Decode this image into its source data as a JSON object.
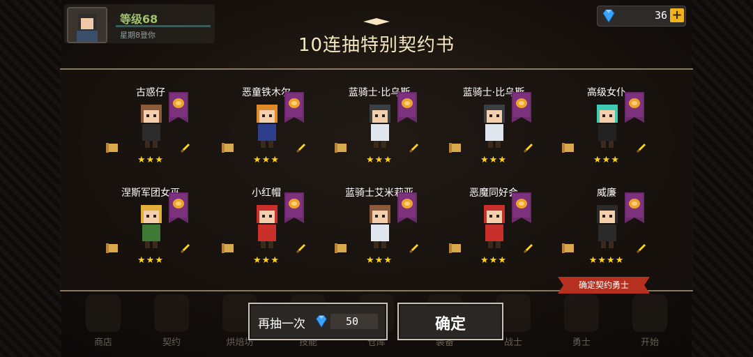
{
  "header": {
    "player_level": "等级68",
    "player_subtitle": "星期8登你",
    "gem_count": "36",
    "gem_plus": "+",
    "title": "10连抽特别契约书"
  },
  "cards": [
    {
      "name": "古惑仔",
      "stars": "★★★",
      "hair": "#8a5a3a",
      "outfit": "#2b2b2b",
      "weapon": "sword-icon"
    },
    {
      "name": "恶童铁木尔",
      "stars": "★★★",
      "hair": "#e08a2a",
      "outfit": "#2d3f8a",
      "weapon": "sword-icon"
    },
    {
      "name": "蓝骑士·比乌斯",
      "stars": "★★★",
      "hair": "#3a3f44",
      "outfit": "#dfe6ee",
      "weapon": "magic-orb-icon"
    },
    {
      "name": "蓝骑士·比乌斯",
      "stars": "★★★",
      "hair": "#3a3f44",
      "outfit": "#dfe6ee",
      "weapon": "magic-orb-icon"
    },
    {
      "name": "高级女仆",
      "stars": "★★★",
      "hair": "#3fcab3",
      "outfit": "#222222",
      "weapon": "magic-orb-icon"
    },
    {
      "name": "涅斯军团女巫",
      "stars": "★★★",
      "hair": "#e3b13a",
      "outfit": "#3e7a35",
      "weapon": "staff-icon"
    },
    {
      "name": "小红帽",
      "stars": "★★★",
      "hair": "#c9302c",
      "outfit": "#c9302c",
      "weapon": "sword-icon"
    },
    {
      "name": "蓝骑士艾米莉亚",
      "stars": "★★★",
      "hair": "#8a5a3a",
      "outfit": "#dfe6ee",
      "weapon": "arrow-icon"
    },
    {
      "name": "恶魔同好会",
      "stars": "★★★",
      "hair": "#c9302c",
      "outfit": "#c9302c",
      "weapon": "axe-icon"
    },
    {
      "name": "威廉",
      "stars": "★★★★",
      "hair": "#2a2a2a",
      "outfit": "#2a2a2a",
      "weapon": "sword-icon"
    }
  ],
  "confirm_tag": "确定契约勇士",
  "bottom_nav": [
    "商店",
    "契约",
    "烘焙坊",
    "技能",
    "仓库",
    "装备",
    "战士",
    "勇士",
    "开始"
  ],
  "buttons": {
    "redraw_label": "再抽一次",
    "redraw_cost": "50",
    "ok_label": "确定"
  },
  "colors": {
    "accent_gold": "#ffd21a",
    "banner_purple": "#6b2a6b",
    "tag_red": "#b6301f",
    "gem_blue": "#3aa3ff"
  }
}
